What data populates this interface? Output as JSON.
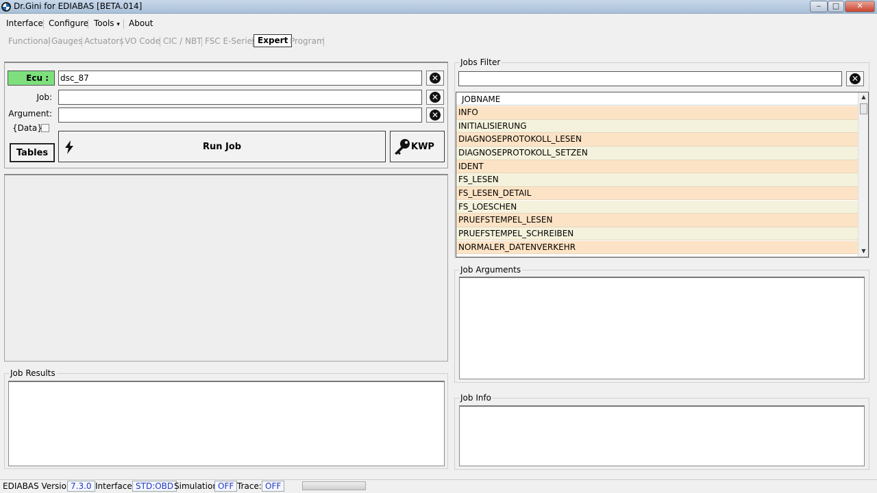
{
  "window": {
    "title": "Dr.Gini for EDIABAS [BETA.014]",
    "buttons": {
      "minimize": "‒",
      "maximize": "□",
      "close": "✕"
    }
  },
  "menu": {
    "items": [
      "Interface",
      "Configure",
      "Tools",
      "About"
    ],
    "tools_arrow": "▾"
  },
  "tabs": [
    "Functional",
    "Gauges",
    "Actuators",
    "VO Code",
    "CIC / NBT",
    "FSC E-Series",
    "Expert",
    "Program"
  ],
  "active_tab": "Expert",
  "form": {
    "ecu_label": "Ecu :",
    "ecu_value": "dsc_87",
    "job_label": "Job:",
    "job_value": "",
    "argument_label": "Argument:",
    "argument_value": "",
    "data_label": "{Data}",
    "data_checked": false,
    "clear_glyph": "✕"
  },
  "buttons": {
    "tables": "Tables",
    "run_job": "Run Job",
    "kwp": "KWP"
  },
  "jobs_filter": {
    "title": "Jobs Filter",
    "value": ""
  },
  "jobs_grid": {
    "header": "JOBNAME",
    "rows": [
      "INFO",
      "INITIALISIERUNG",
      "DIAGNOSEPROTOKOLL_LESEN",
      "DIAGNOSEPROTOKOLL_SETZEN",
      "IDENT",
      "FS_LESEN",
      "FS_LESEN_DETAIL",
      "FS_LOESCHEN",
      "PRUEFSTEMPEL_LESEN",
      "PRUEFSTEMPEL_SCHREIBEN",
      "NORMALER_DATENVERKEHR"
    ],
    "scroll_up": "▲",
    "scroll_down": "▼"
  },
  "sections": {
    "job_arguments": "Job Arguments",
    "job_results": "Job Results",
    "job_info": "Job Info"
  },
  "status": {
    "ediabas_label": "EDIABAS Version:",
    "ediabas_value": "7.3.0",
    "interface_label": "Interface:",
    "interface_value": "STD:OBD",
    "simulation_label": "Simulation:",
    "simulation_value": "OFF",
    "trace_label": "Trace:",
    "trace_value": "OFF"
  },
  "colors": {
    "ecu_highlight": "#7de07d",
    "row_odd": "#fde3c5",
    "row_even": "#f4f2dc",
    "status_value": "#1f3bbf"
  }
}
